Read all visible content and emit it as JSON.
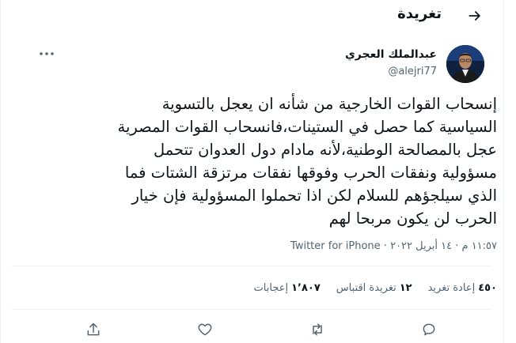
{
  "header": {
    "title": "تغريدة",
    "back_icon": "arrow-back-icon"
  },
  "author": {
    "name": "عبدالملك العجري",
    "handle": "@alejri77",
    "avatar_icon": "avatar"
  },
  "tweet": {
    "text": "إنسحاب القوات الخارجية من شأنه ان يعجل بالتسوية\nالسياسية كما حصل في الستينات،فانسحاب القوات المصرية\nعجل بالمصالحة الوطنية،لأنه مادام دول العدوان تتحمل\nمسؤولية ونفقات الحرب وفوقها نفقات مرتزقة الشتات فما\nالذي سيلجؤهم للسلام لكن اذا تحملوا المسؤولية فإن خيار\nالحرب لن يكون مربحا لهم",
    "time": "١١:٥٧ م · ١٤ أبريل ٢٠٢٢",
    "separator": "·",
    "source": "Twitter for iPhone"
  },
  "stats": {
    "retweets_count": "٤٥٠",
    "retweets_label": "إعادة تغريد",
    "quotes_count": "١٢",
    "quotes_label": "تغريدة اقتباس",
    "likes_count": "١٬٨٠٧",
    "likes_label": "إعجابات"
  },
  "actions": {
    "reply_icon": "reply-icon",
    "retweet_icon": "retweet-icon",
    "like_icon": "heart-icon",
    "share_icon": "share-icon"
  },
  "colors": {
    "text": "#0f1419",
    "secondary": "#536471",
    "divider": "#eff3f4"
  }
}
